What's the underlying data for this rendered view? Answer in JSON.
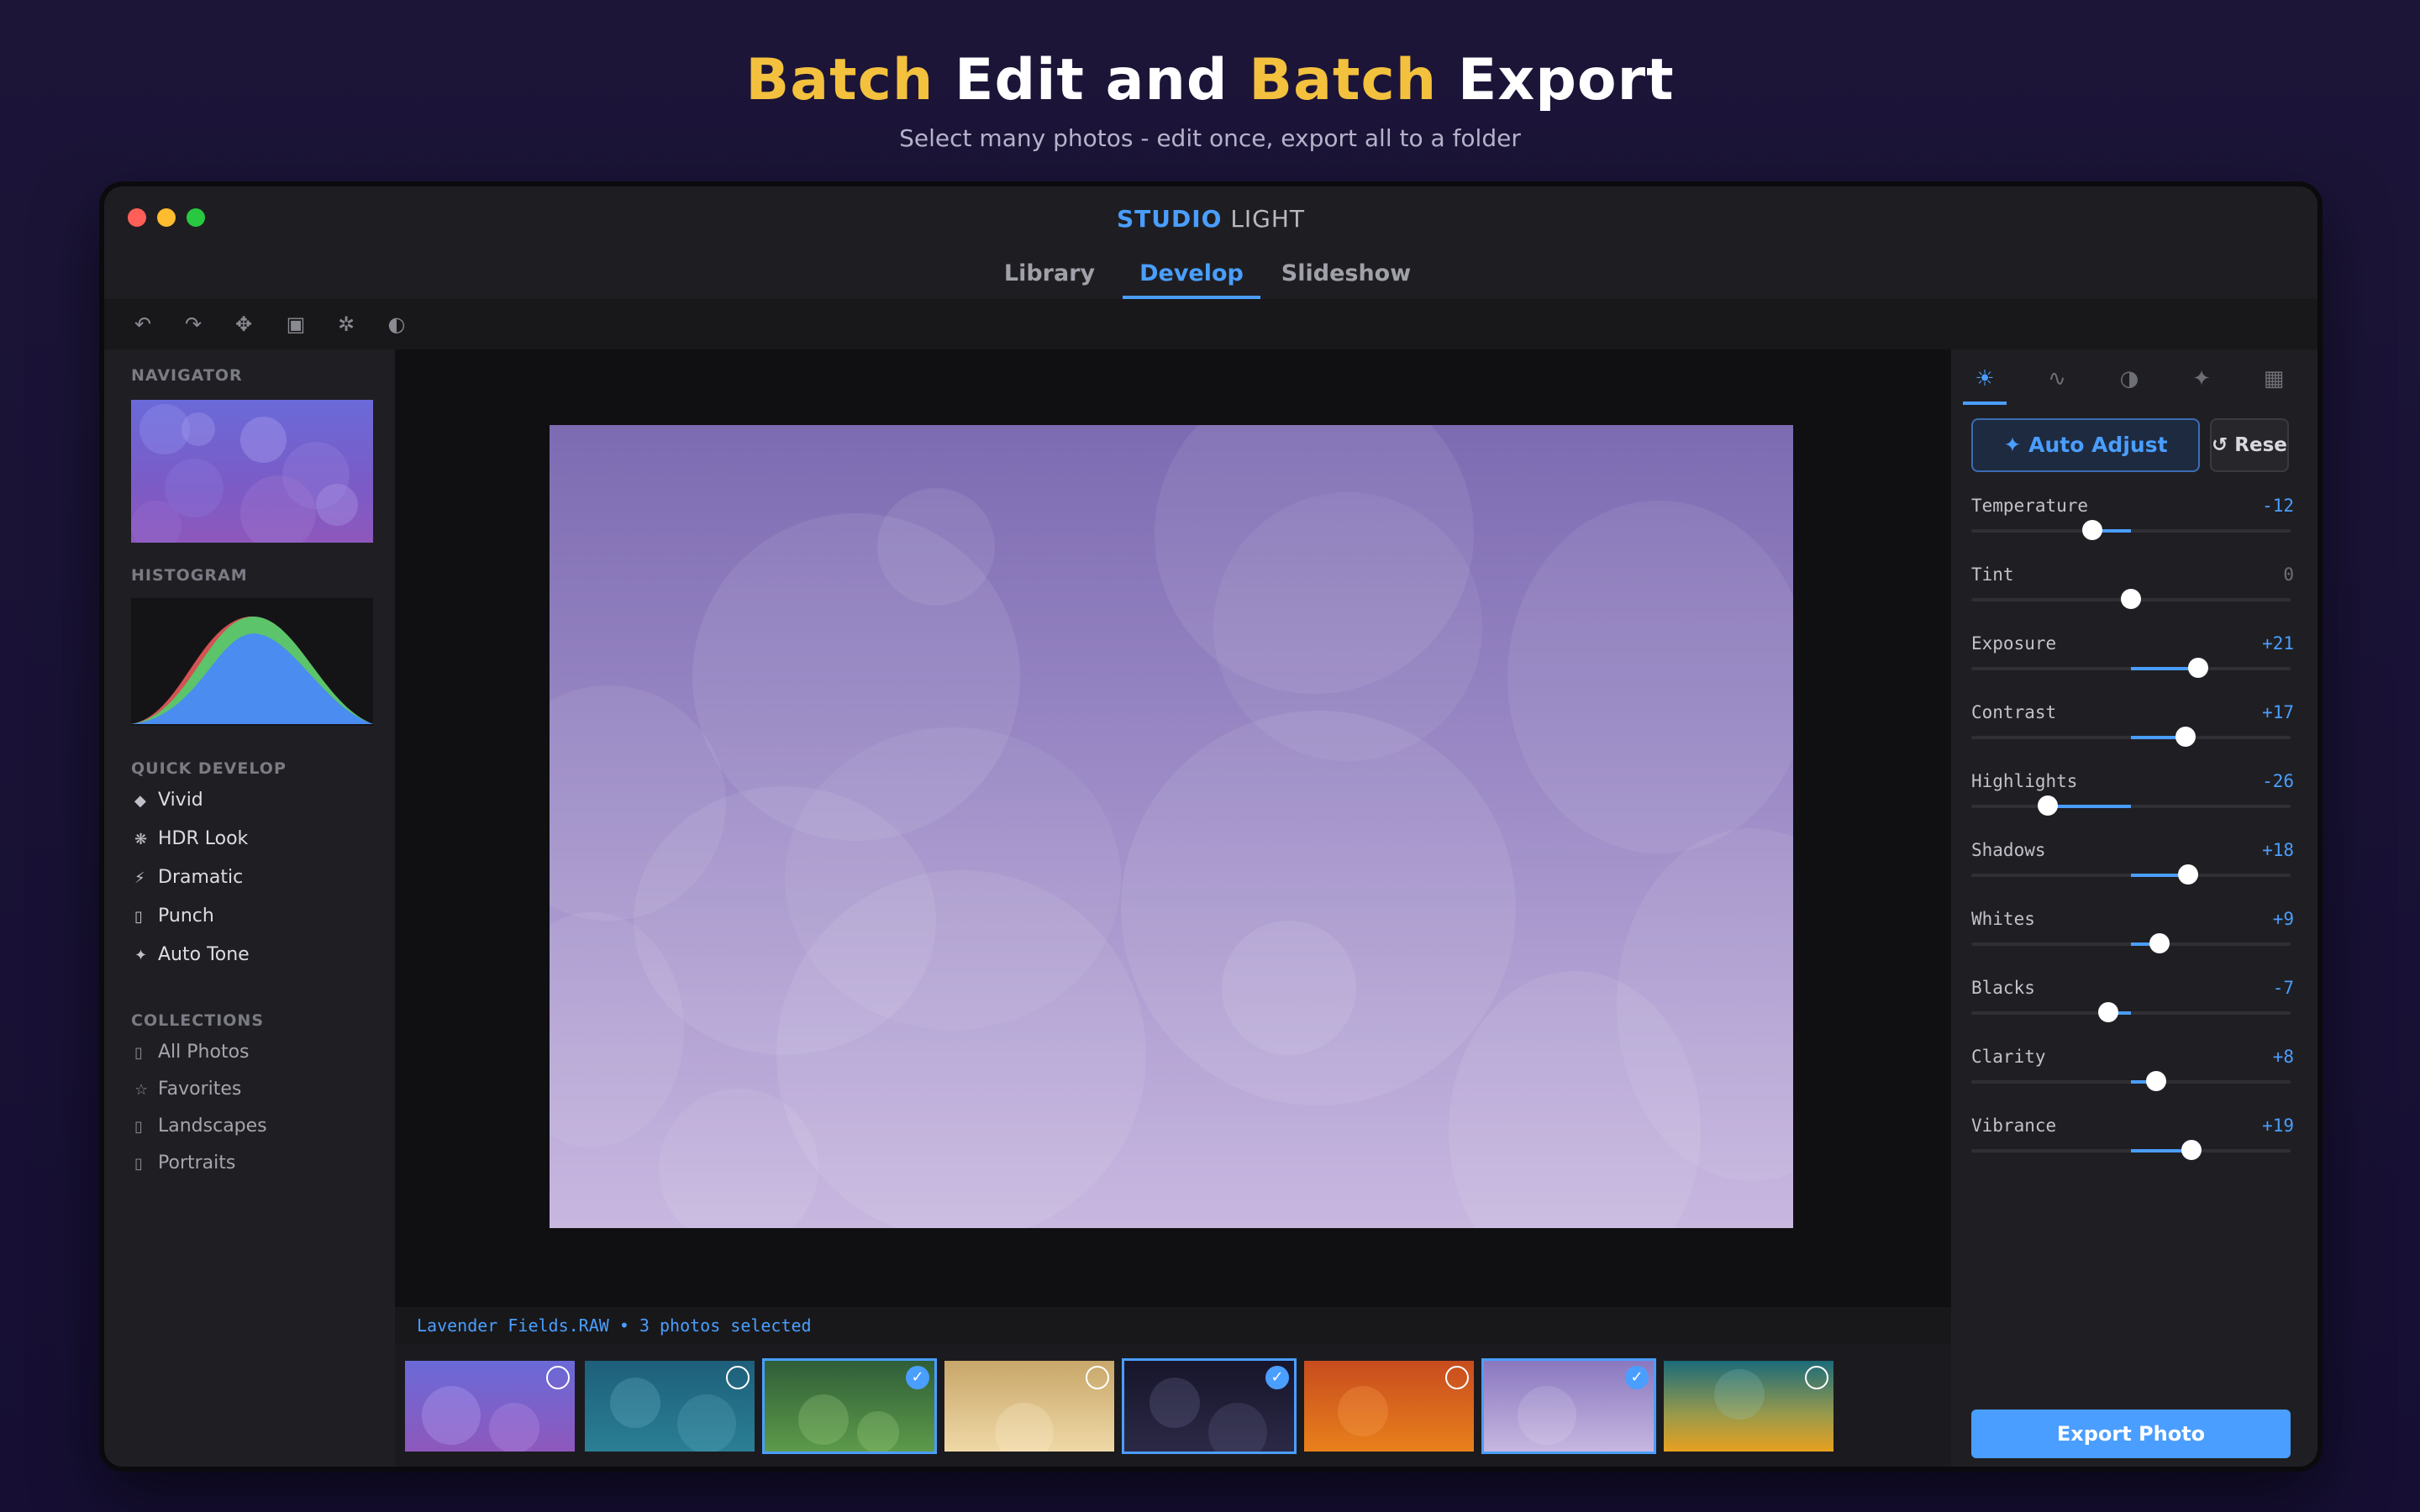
{
  "hero": {
    "title_word1": "Batch",
    "title_word2": " Edit and ",
    "title_word3": "Batch",
    "title_word4": " Export",
    "subtitle": "Select many photos - edit once, export all to a folder"
  },
  "app": {
    "brand": "STUDIO",
    "name": " LIGHT"
  },
  "tabs": [
    {
      "label": "Library",
      "active": false
    },
    {
      "label": "Develop",
      "active": true
    },
    {
      "label": "Slideshow",
      "active": false
    }
  ],
  "toolbar_icons": [
    "undo-icon",
    "redo-icon",
    "move-icon",
    "crop-icon",
    "brush-icon",
    "contrast-icon"
  ],
  "left_panel": {
    "navigator_label": "NAVIGATOR",
    "histogram_label": "HISTOGRAM",
    "quick_develop_label": "QUICK DEVELOP",
    "quick_develop": [
      {
        "icon": "◆",
        "label": "Vivid"
      },
      {
        "icon": "❋",
        "label": "HDR Look"
      },
      {
        "icon": "⚡",
        "label": "Dramatic"
      },
      {
        "icon": "▯",
        "label": "Punch"
      },
      {
        "icon": "✦",
        "label": "Auto Tone"
      }
    ],
    "collections_label": "COLLECTIONS",
    "collections": [
      {
        "icon": "▯",
        "label": "All Photos"
      },
      {
        "icon": "☆",
        "label": "Favorites"
      },
      {
        "icon": "▯",
        "label": "Landscapes"
      },
      {
        "icon": "▯",
        "label": "Portraits"
      }
    ]
  },
  "status_text": "Lavender Fields.RAW • 3 photos selected",
  "filmstrip": [
    {
      "name": "thumb-violet",
      "selected": false,
      "check": ""
    },
    {
      "name": "thumb-teal",
      "selected": false,
      "check": ""
    },
    {
      "name": "thumb-green",
      "selected": true,
      "check": "✓"
    },
    {
      "name": "thumb-sand",
      "selected": false,
      "check": ""
    },
    {
      "name": "thumb-night",
      "selected": true,
      "check": "✓"
    },
    {
      "name": "thumb-orange",
      "selected": false,
      "check": ""
    },
    {
      "name": "thumb-lavender",
      "selected": true,
      "check": "✓"
    },
    {
      "name": "thumb-sunset-teal",
      "selected": false,
      "check": ""
    }
  ],
  "right_panel": {
    "panel_tabs": [
      "☀",
      "∿",
      "◑",
      "✦",
      "▦"
    ],
    "auto_adjust": "✦ Auto Adjust",
    "reset": "↺ Reset",
    "sliders": [
      {
        "label": "Temperature",
        "value": "-12",
        "level": -12
      },
      {
        "label": "Tint",
        "value": "0",
        "level": 0
      },
      {
        "label": "Exposure",
        "value": "+21",
        "level": 21
      },
      {
        "label": "Contrast",
        "value": "+17",
        "level": 17
      },
      {
        "label": "Highlights",
        "value": "-26",
        "level": -26
      },
      {
        "label": "Shadows",
        "value": "+18",
        "level": 18
      },
      {
        "label": "Whites",
        "value": "+9",
        "level": 9
      },
      {
        "label": "Blacks",
        "value": "-7",
        "level": -7
      },
      {
        "label": "Clarity",
        "value": "+8",
        "level": 8
      },
      {
        "label": "Vibrance",
        "value": "+19",
        "level": 19
      }
    ],
    "export": "Export Photo"
  },
  "colors": {
    "accent": "#4a9eff",
    "title_accent": "#f3c13d"
  }
}
